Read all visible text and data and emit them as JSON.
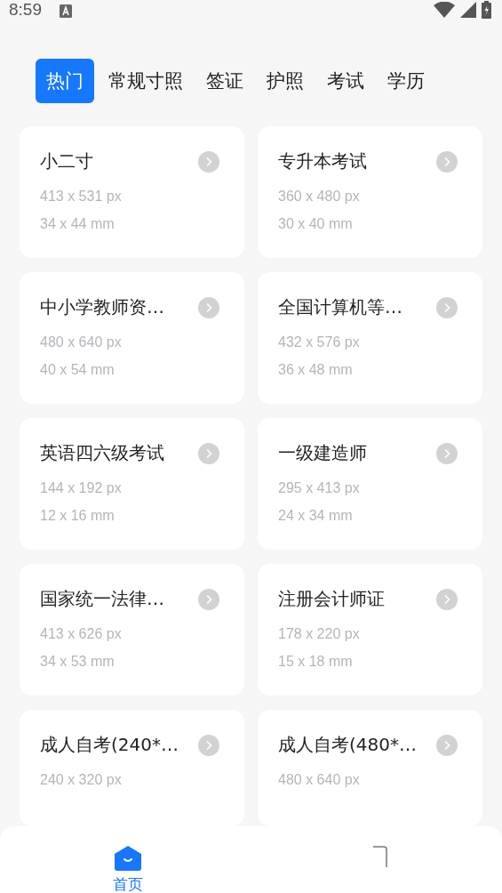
{
  "status_bar": {
    "time": "8:59"
  },
  "tabs": [
    {
      "label": "热门",
      "selected": true
    },
    {
      "label": "常规寸照",
      "selected": false
    },
    {
      "label": "签证",
      "selected": false
    },
    {
      "label": "护照",
      "selected": false
    },
    {
      "label": "考试",
      "selected": false
    },
    {
      "label": "学历",
      "selected": false
    }
  ],
  "cards": [
    {
      "title": "小二寸",
      "px": "413 x 531 px",
      "mm": "34 x 44 mm"
    },
    {
      "title": "专升本考试",
      "px": "360 x 480 px",
      "mm": "30 x 40 mm"
    },
    {
      "title": "中小学教师资…",
      "px": "480 x 640 px",
      "mm": "40 x 54 mm"
    },
    {
      "title": "全国计算机等…",
      "px": "432 x 576 px",
      "mm": "36 x 48 mm"
    },
    {
      "title": "英语四六级考试",
      "px": "144 x 192 px",
      "mm": "12 x 16 mm"
    },
    {
      "title": "一级建造师",
      "px": "295 x 413 px",
      "mm": "24 x 34 mm"
    },
    {
      "title": "国家统一法律…",
      "px": "413 x 626 px",
      "mm": "34 x 53 mm"
    },
    {
      "title": "注册会计师证",
      "px": "178 x 220 px",
      "mm": "15 x 18 mm"
    },
    {
      "title": "成人自考(240*…",
      "px": "240 x 320 px"
    },
    {
      "title": "成人自考(480*…",
      "px": "480 x 640 px"
    }
  ],
  "bottom_nav": [
    {
      "label": "首页",
      "selected": true
    }
  ]
}
